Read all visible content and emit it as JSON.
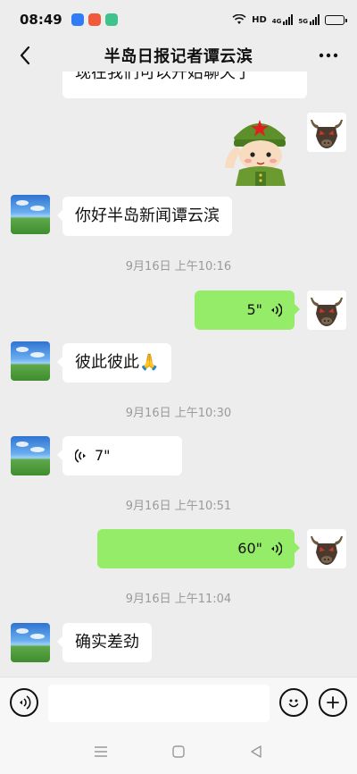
{
  "status": {
    "time": "08:49",
    "network": "HD",
    "signal1_label": "4G",
    "signal2_label": "5G"
  },
  "header": {
    "title": "半岛日报记者谭云滨"
  },
  "messages": {
    "partial_text": "现在我们可以开始聊天了",
    "greeting": "你好半岛新闻谭云滨",
    "ts1": "9月16日 上午10:16",
    "voice_sent_1": "5\"",
    "reply_1": "彼此彼此🙏",
    "ts2": "9月16日 上午10:30",
    "voice_recv_1": "7\"",
    "ts3": "9月16日 上午10:51",
    "voice_sent_2": "60\"",
    "ts4": "9月16日 上午11:04",
    "reply_2": "确实差劲"
  },
  "colors": {
    "background": "#ededed",
    "sent_bubble": "#95ec69",
    "recv_bubble": "#ffffff",
    "timestamp": "#9a9a9a"
  },
  "icons": {
    "back": "chevron-left-icon",
    "more": "more-dots-icon",
    "voice_toggle": "voice-icon",
    "emoji": "emoji-icon",
    "add": "plus-icon"
  },
  "battery_level": 0.8
}
